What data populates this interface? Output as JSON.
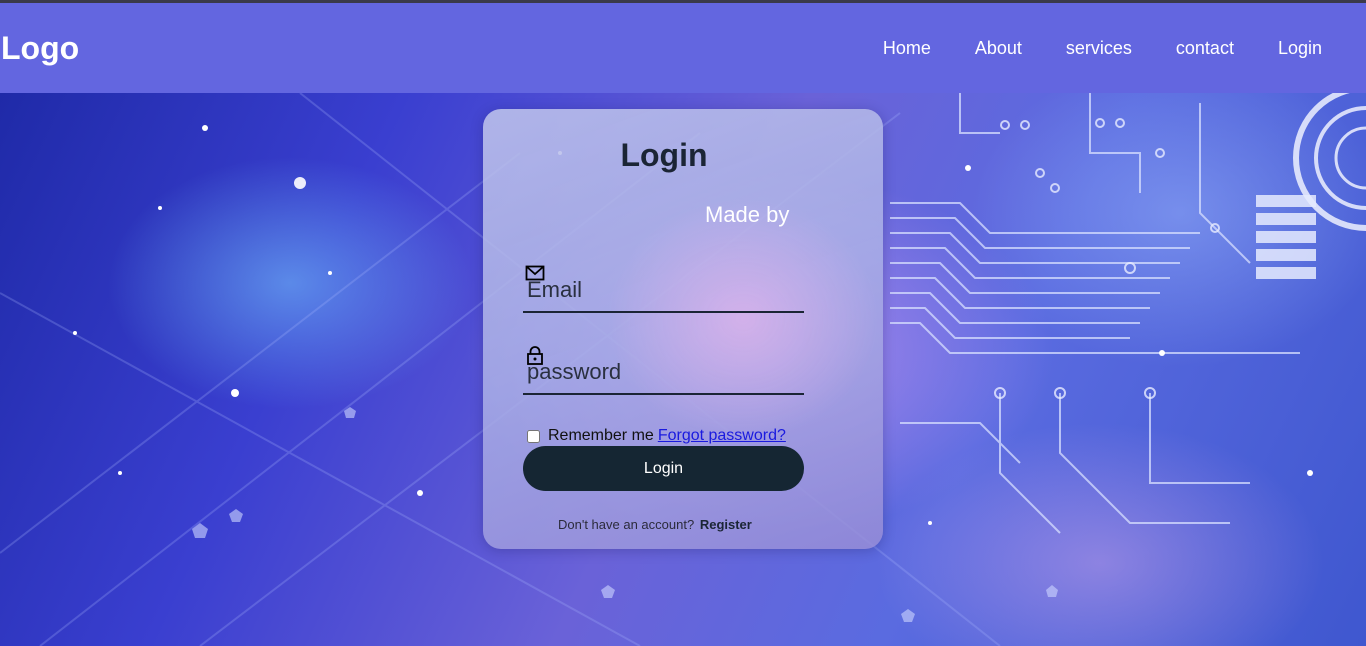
{
  "header": {
    "logo": "Logo",
    "nav": [
      {
        "label": "Home"
      },
      {
        "label": "About"
      },
      {
        "label": "services"
      },
      {
        "label": "contact"
      },
      {
        "label": "Login"
      }
    ]
  },
  "login_card": {
    "title": "Login",
    "made_by": "Made by",
    "email": {
      "placeholder": "Email",
      "icon": "mail-icon"
    },
    "password": {
      "placeholder": "password",
      "icon": "lock-icon"
    },
    "remember_label": "Remember me",
    "forgot_label": "Forgot password?",
    "submit_label": "Login",
    "register_prompt": "Don't have an account?",
    "register_link": "Register"
  },
  "colors": {
    "header_bg": "#6366e0",
    "button_bg": "#152633",
    "link": "#1a1adf"
  }
}
